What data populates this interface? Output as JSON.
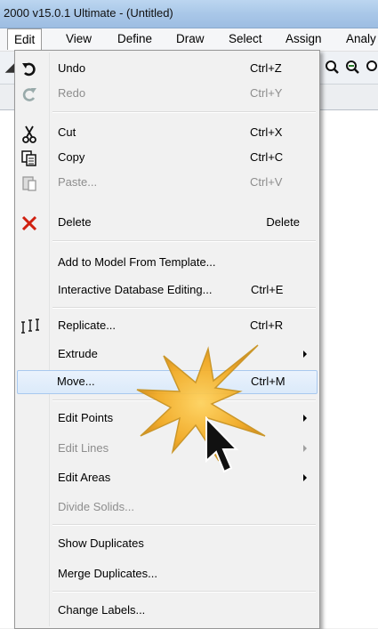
{
  "window": {
    "title": "2000 v15.0.1 Ultimate  - (Untitled)"
  },
  "menubar": {
    "items": [
      "Edit",
      "View",
      "Define",
      "Draw",
      "Select",
      "Assign",
      "Analy"
    ]
  },
  "edit_menu": {
    "undo": {
      "label": "Undo",
      "shortcut": "Ctrl+Z"
    },
    "redo": {
      "label": "Redo",
      "shortcut": "Ctrl+Y"
    },
    "cut": {
      "label": "Cut",
      "shortcut": "Ctrl+X"
    },
    "copy": {
      "label": "Copy",
      "shortcut": "Ctrl+C"
    },
    "paste": {
      "label": "Paste...",
      "shortcut": "Ctrl+V"
    },
    "delete": {
      "label": "Delete",
      "shortcut": "Delete"
    },
    "add_template": {
      "label": "Add to Model From Template..."
    },
    "interactive_db": {
      "label": "Interactive Database Editing...",
      "shortcut": "Ctrl+E"
    },
    "replicate": {
      "label": "Replicate...",
      "shortcut": "Ctrl+R"
    },
    "extrude": {
      "label": "Extrude"
    },
    "move": {
      "label": "Move...",
      "shortcut": "Ctrl+M"
    },
    "edit_points": {
      "label": "Edit Points"
    },
    "edit_lines": {
      "label": "Edit Lines"
    },
    "edit_areas": {
      "label": "Edit Areas"
    },
    "divide_solids": {
      "label": "Divide Solids..."
    },
    "show_duplicates": {
      "label": "Show Duplicates"
    },
    "merge_duplicates": {
      "label": "Merge Duplicates..."
    },
    "change_labels": {
      "label": "Change Labels..."
    }
  },
  "colors": {
    "highlight": "#dbeafa",
    "burst": "#f2a81d",
    "delete_icon": "#d02010"
  },
  "icons": [
    "undo-icon",
    "redo-icon",
    "scissors-icon",
    "copy-icon",
    "paste-icon",
    "delete-x-icon",
    "replicate-icon",
    "zoom-icon",
    "cursor-icon",
    "click-burst-icon"
  ]
}
